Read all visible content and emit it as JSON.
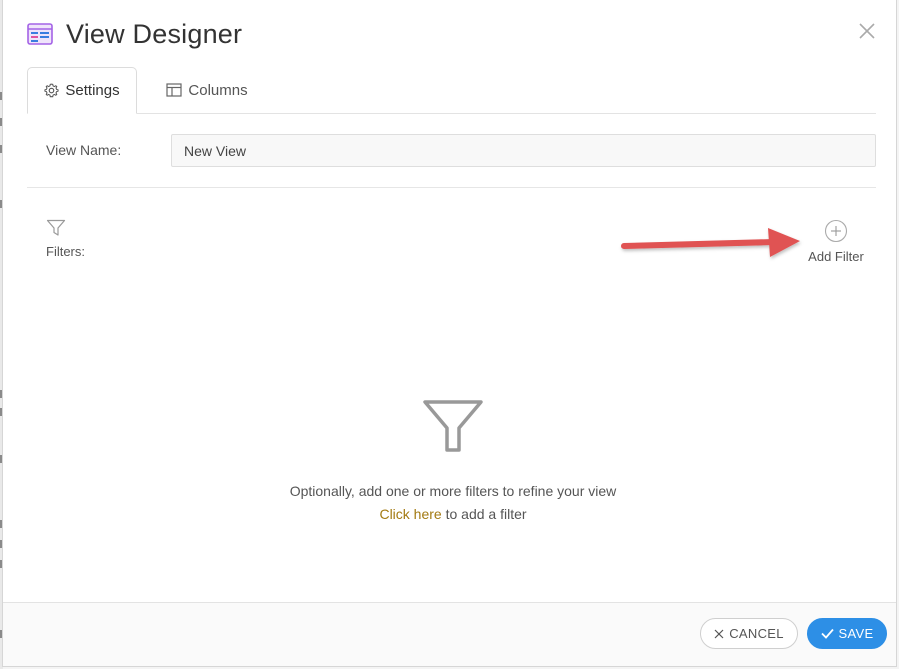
{
  "dialog": {
    "title": "View Designer",
    "title_icon": "view-designer-icon",
    "close_icon": "close-icon"
  },
  "tabs": [
    {
      "label": "Settings",
      "icon": "gear-icon",
      "active": true
    },
    {
      "label": "Columns",
      "icon": "columns-icon",
      "active": false
    }
  ],
  "settings": {
    "view_name_label": "View Name:",
    "view_name_value": "New View"
  },
  "filters": {
    "label": "Filters:",
    "icon": "filter-icon",
    "add_filter_label": "Add Filter",
    "add_filter_icon": "plus-circle-icon",
    "empty_message": "Optionally, add one or more filters to refine your view",
    "empty_link_text": "Click here",
    "empty_link_suffix": " to add a filter"
  },
  "annotation": {
    "arrow_color": "#e05252"
  },
  "footer": {
    "cancel_label": "CANCEL",
    "save_label": "SAVE"
  },
  "colors": {
    "accent": "#2d8fe6",
    "link": "#a37a12"
  }
}
